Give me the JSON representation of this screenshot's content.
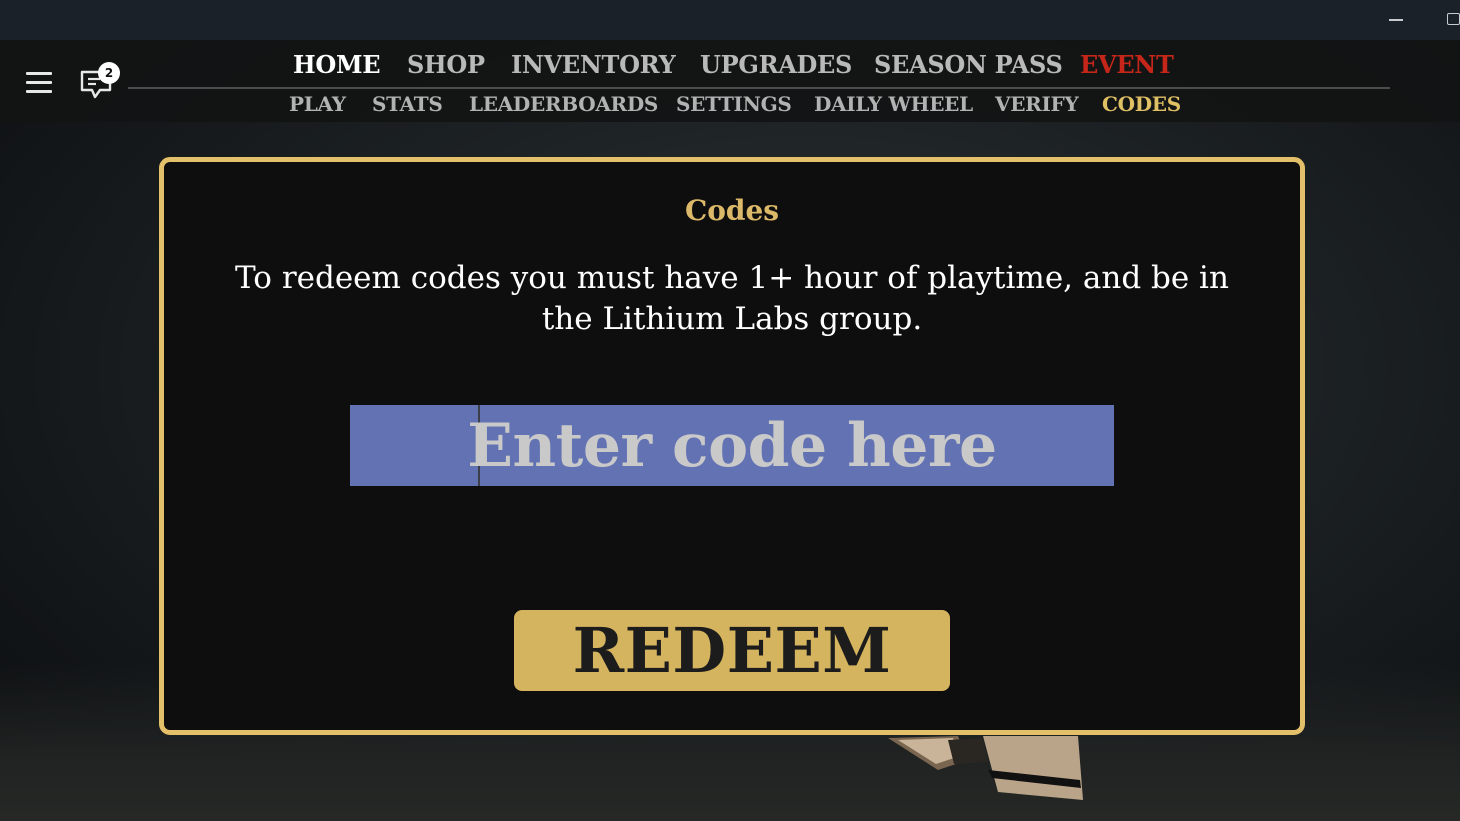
{
  "topbar": {
    "chat_badge_count": "2",
    "primary_nav": [
      {
        "label": "HOME",
        "state": "active"
      },
      {
        "label": "SHOP"
      },
      {
        "label": "INVENTORY"
      },
      {
        "label": "UPGRADES"
      },
      {
        "label": "SEASON PASS"
      },
      {
        "label": "EVENT",
        "color": "#c6261a"
      }
    ],
    "secondary_nav": [
      {
        "label": "PLAY"
      },
      {
        "label": "STATS"
      },
      {
        "label": "LEADERBOARDS"
      },
      {
        "label": "SETTINGS"
      },
      {
        "label": "DAILY WHEEL"
      },
      {
        "label": "VERIFY"
      },
      {
        "label": "CODES",
        "state": "selected",
        "color": "#e0c064"
      }
    ]
  },
  "codes_panel": {
    "title": "Codes",
    "description": "To redeem codes you must have 1+ hour of playtime, and be in the Lithium Labs group.",
    "input_placeholder": "Enter code here",
    "redeem_label": "REDEEM"
  },
  "colors": {
    "accent_gold": "#e3c06a",
    "button_gold": "#d5b45f",
    "input_blue": "#6272b2",
    "event_red": "#c6261a"
  }
}
